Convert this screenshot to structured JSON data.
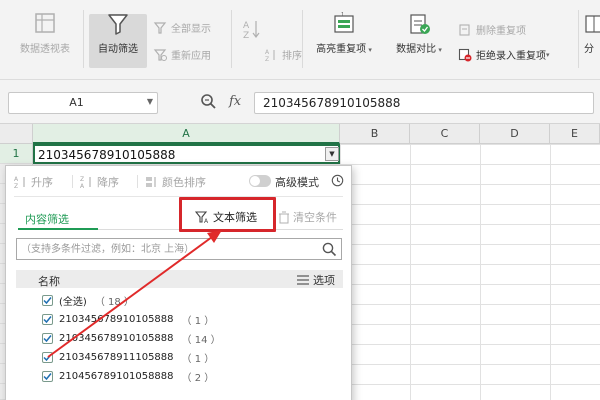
{
  "ribbon": {
    "pivot_table": "数据透视表",
    "auto_filter": "自动筛选",
    "show_all": "全部显示",
    "reapply": "重新应用",
    "az_label": "A↓Z",
    "sort": "排序",
    "highlight_duplicates": "高亮重复项",
    "data_compare": "数据对比",
    "delete_duplicates": "删除重复项",
    "reject_duplicates": "拒绝录入重复项",
    "split": "分"
  },
  "formula_bar": {
    "name_box": "A1",
    "fx": "fx",
    "value": "210345678910105888"
  },
  "grid": {
    "columns": [
      "A",
      "B",
      "C",
      "D",
      "E"
    ],
    "rows": [
      "1"
    ],
    "cell_a1": "210345678910105888"
  },
  "filter_panel": {
    "sort_asc": "升序",
    "sort_desc": "降序",
    "sort_color": "颜色排序",
    "advanced_mode": "高级模式",
    "tab_content": "内容筛选",
    "text_filter": "文本筛选",
    "clear_conditions": "清空条件",
    "search_placeholder": "（支持多条件过滤，例如：北京 上海）",
    "list_header_name": "名称",
    "list_header_options": "选项",
    "items": [
      {
        "label": "(全选)",
        "count": "（ 18 ）"
      },
      {
        "label": "210345678910105888",
        "count": "（ 1 ）"
      },
      {
        "label": "210345678910105888",
        "count": "（ 14 ）"
      },
      {
        "label": "210345678911105888",
        "count": "（ 1 ）"
      },
      {
        "label": "210456789101058888",
        "count": "（ 2 ）"
      }
    ]
  },
  "colors": {
    "accent_green": "#1f9b55",
    "highlight_red": "#d6262b"
  }
}
